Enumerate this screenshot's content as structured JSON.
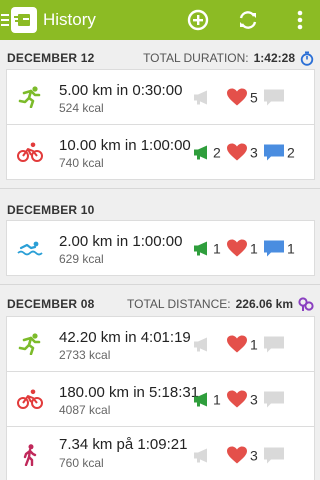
{
  "appbar": {
    "title": "History"
  },
  "sections": [
    {
      "date": "DECEMBER 12",
      "summary_label": "TOTAL DURATION:",
      "summary_value": "1:42:28",
      "summary_icon": "stopwatch-icon",
      "workouts": [
        {
          "sport": "running",
          "main": "5.00 km in 0:30:00",
          "kcal": "524 kcal",
          "peptalks": "",
          "likes": "5",
          "comments": "",
          "peptalk_active": false,
          "comment_active": false
        },
        {
          "sport": "cycling",
          "main": "10.00 km in 1:00:00",
          "kcal": "740 kcal",
          "peptalks": "2",
          "likes": "3",
          "comments": "2",
          "peptalk_active": true,
          "comment_active": true
        }
      ]
    },
    {
      "date": "DECEMBER 10",
      "workouts": [
        {
          "sport": "swimming",
          "main": "2.00 km in 1:00:00",
          "kcal": "629 kcal",
          "peptalks": "1",
          "likes": "1",
          "comments": "1",
          "peptalk_active": true,
          "comment_active": true
        }
      ]
    },
    {
      "date": "DECEMBER 08",
      "summary_label": "TOTAL DISTANCE:",
      "summary_value": "226.06 km",
      "summary_icon": "distance-pin-icon",
      "workouts": [
        {
          "sport": "running",
          "main": "42.20 km in 4:01:19",
          "kcal": "2733 kcal",
          "peptalks": "",
          "likes": "1",
          "comments": "",
          "peptalk_active": false,
          "comment_active": false
        },
        {
          "sport": "cycling",
          "main": "180.00 km in 5:18:31",
          "kcal": "4087 kcal",
          "peptalks": "1",
          "likes": "3",
          "comments": "",
          "peptalk_active": true,
          "comment_active": false
        },
        {
          "sport": "walking",
          "main": "7.34 km på 1:09:21",
          "kcal": "760 kcal",
          "peptalks": "",
          "likes": "3",
          "comments": "",
          "peptalk_active": false,
          "comment_active": false
        }
      ]
    }
  ],
  "colors": {
    "brand": "#8cbb24",
    "heart": "#e4504a",
    "peptalk": "#2f9e3c",
    "comment": "#4a8de0",
    "inactive": "#d9d9d9",
    "running": "#7cbb2a",
    "cycling": "#e23b3b",
    "swimming": "#2a9fd6",
    "walking": "#c0285a"
  }
}
